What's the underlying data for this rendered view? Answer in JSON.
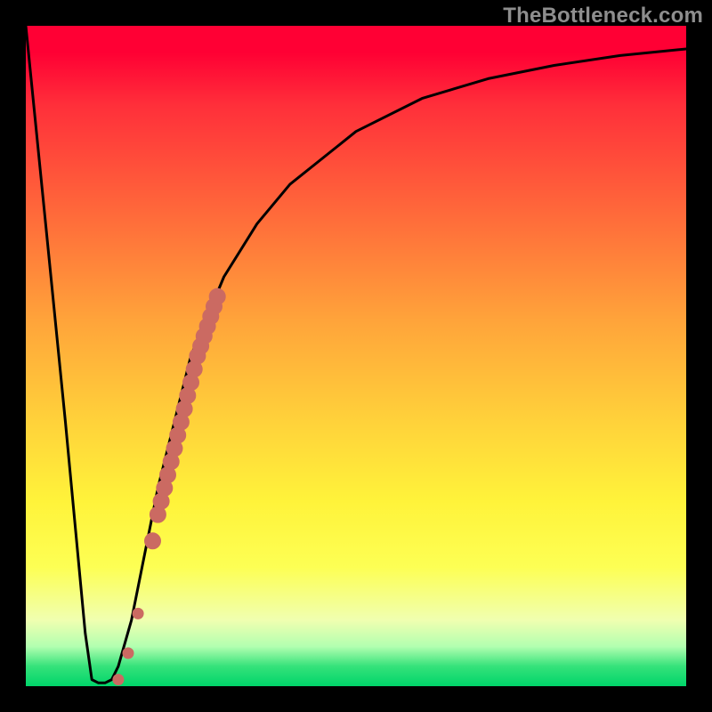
{
  "watermark": "TheBottleneck.com",
  "colors": {
    "curve_stroke": "#000000",
    "marker_fill": "#cb6a62",
    "marker_stroke": "#cb6a62"
  },
  "chart_data": {
    "type": "line",
    "title": "",
    "xlabel": "",
    "ylabel": "",
    "xlim": [
      0,
      100
    ],
    "ylim": [
      0,
      100
    ],
    "series": [
      {
        "name": "bottleneck-curve",
        "x": [
          0,
          3,
          6,
          9,
          10,
          11,
          12,
          13,
          14,
          16,
          20,
          25,
          30,
          35,
          40,
          50,
          60,
          70,
          80,
          90,
          100
        ],
        "y": [
          100,
          70,
          40,
          8,
          1,
          0.5,
          0.5,
          1,
          3,
          10,
          30,
          50,
          62,
          70,
          76,
          84,
          89,
          92,
          94,
          95.5,
          96.5
        ]
      }
    ],
    "markers": {
      "name": "highlighted-points",
      "x": [
        14.0,
        15.5,
        17.0,
        19.2,
        20.0,
        20.5,
        21.0,
        21.5,
        22.0,
        22.5,
        23.0,
        23.5,
        24.0,
        24.5,
        25.0,
        25.5,
        26.0,
        26.5,
        27.0,
        27.5,
        28.0,
        28.5,
        29.0
      ],
      "y": [
        1,
        5,
        11,
        22,
        26,
        28,
        30,
        32,
        34,
        36,
        38,
        40,
        42,
        44,
        46,
        48,
        50,
        51.5,
        53,
        54.5,
        56,
        57.5,
        59
      ]
    }
  }
}
